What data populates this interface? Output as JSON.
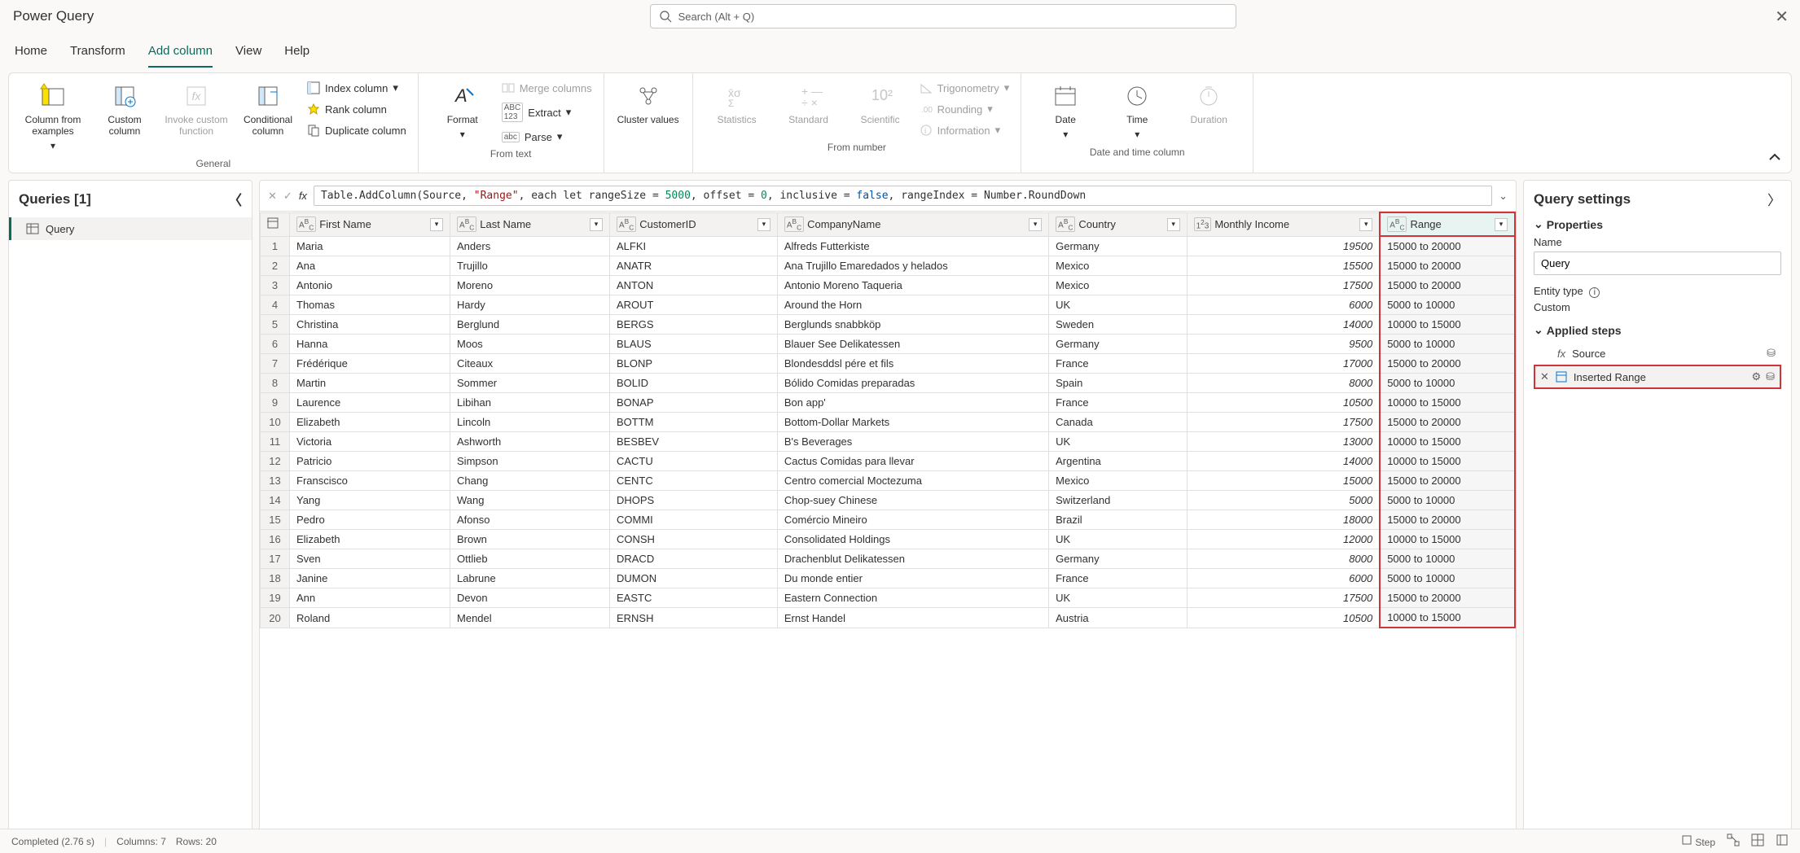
{
  "app": {
    "title": "Power Query",
    "search_placeholder": "Search (Alt + Q)"
  },
  "tabs": {
    "home": "Home",
    "transform": "Transform",
    "addcolumn": "Add column",
    "view": "View",
    "help": "Help"
  },
  "ribbon": {
    "general": {
      "col_from_examples": "Column from examples",
      "custom_column": "Custom column",
      "invoke_custom_function": "Invoke custom function",
      "conditional_column": "Conditional column",
      "index_column": "Index column",
      "rank_column": "Rank column",
      "duplicate_column": "Duplicate column",
      "label": "General"
    },
    "from_text": {
      "format": "Format",
      "merge_columns": "Merge columns",
      "extract": "Extract",
      "parse": "Parse",
      "label": "From text"
    },
    "cluster": {
      "cluster_values": "Cluster values"
    },
    "from_number": {
      "statistics": "Statistics",
      "standard": "Standard",
      "scientific": "Scientific",
      "trigonometry": "Trigonometry",
      "rounding": "Rounding",
      "information": "Information",
      "label": "From number"
    },
    "date_time": {
      "date": "Date",
      "time": "Time",
      "duration": "Duration",
      "label": "Date and time column"
    }
  },
  "queries_panel": {
    "title": "Queries [1]",
    "items": [
      "Query"
    ]
  },
  "formula": {
    "prefix": "Table.AddColumn(Source, ",
    "str": "\"Range\"",
    "mid": ", each let rangeSize = ",
    "n1": "5000",
    "mid2": ", offset = ",
    "n2": "0",
    "mid3": ", inclusive = ",
    "kw": "false",
    "mid4": ", rangeIndex = Number.RoundDown"
  },
  "columns": [
    "First Name",
    "Last Name",
    "CustomerID",
    "CompanyName",
    "Country",
    "Monthly Income",
    "Range"
  ],
  "rows": [
    {
      "n": 1,
      "fn": "Maria",
      "ln": "Anders",
      "cid": "ALFKI",
      "co": "Alfreds Futterkiste",
      "ct": "Germany",
      "mi": "19500",
      "rg": "15000 to 20000"
    },
    {
      "n": 2,
      "fn": "Ana",
      "ln": "Trujillo",
      "cid": "ANATR",
      "co": "Ana Trujillo Emaredados y helados",
      "ct": "Mexico",
      "mi": "15500",
      "rg": "15000 to 20000"
    },
    {
      "n": 3,
      "fn": "Antonio",
      "ln": "Moreno",
      "cid": "ANTON",
      "co": "Antonio Moreno Taqueria",
      "ct": "Mexico",
      "mi": "17500",
      "rg": "15000 to 20000"
    },
    {
      "n": 4,
      "fn": "Thomas",
      "ln": "Hardy",
      "cid": "AROUT",
      "co": "Around the Horn",
      "ct": "UK",
      "mi": "6000",
      "rg": "5000 to 10000"
    },
    {
      "n": 5,
      "fn": "Christina",
      "ln": "Berglund",
      "cid": "BERGS",
      "co": "Berglunds snabbköp",
      "ct": "Sweden",
      "mi": "14000",
      "rg": "10000 to 15000"
    },
    {
      "n": 6,
      "fn": "Hanna",
      "ln": "Moos",
      "cid": "BLAUS",
      "co": "Blauer See Delikatessen",
      "ct": "Germany",
      "mi": "9500",
      "rg": "5000 to 10000"
    },
    {
      "n": 7,
      "fn": "Frédérique",
      "ln": "Citeaux",
      "cid": "BLONP",
      "co": "Blondesddsl pére et fils",
      "ct": "France",
      "mi": "17000",
      "rg": "15000 to 20000"
    },
    {
      "n": 8,
      "fn": "Martin",
      "ln": "Sommer",
      "cid": "BOLID",
      "co": "Bólido Comidas preparadas",
      "ct": "Spain",
      "mi": "8000",
      "rg": "5000 to 10000"
    },
    {
      "n": 9,
      "fn": "Laurence",
      "ln": "Libihan",
      "cid": "BONAP",
      "co": "Bon app'",
      "ct": "France",
      "mi": "10500",
      "rg": "10000 to 15000"
    },
    {
      "n": 10,
      "fn": "Elizabeth",
      "ln": "Lincoln",
      "cid": "BOTTM",
      "co": "Bottom-Dollar Markets",
      "ct": "Canada",
      "mi": "17500",
      "rg": "15000 to 20000"
    },
    {
      "n": 11,
      "fn": "Victoria",
      "ln": "Ashworth",
      "cid": "BESBEV",
      "co": "B's Beverages",
      "ct": "UK",
      "mi": "13000",
      "rg": "10000 to 15000"
    },
    {
      "n": 12,
      "fn": "Patricio",
      "ln": "Simpson",
      "cid": "CACTU",
      "co": "Cactus Comidas para llevar",
      "ct": "Argentina",
      "mi": "14000",
      "rg": "10000 to 15000"
    },
    {
      "n": 13,
      "fn": "Franscisco",
      "ln": "Chang",
      "cid": "CENTC",
      "co": "Centro comercial Moctezuma",
      "ct": "Mexico",
      "mi": "15000",
      "rg": "15000 to 20000"
    },
    {
      "n": 14,
      "fn": "Yang",
      "ln": "Wang",
      "cid": "DHOPS",
      "co": "Chop-suey Chinese",
      "ct": "Switzerland",
      "mi": "5000",
      "rg": "5000 to 10000"
    },
    {
      "n": 15,
      "fn": "Pedro",
      "ln": "Afonso",
      "cid": "COMMI",
      "co": "Comércio Mineiro",
      "ct": "Brazil",
      "mi": "18000",
      "rg": "15000 to 20000"
    },
    {
      "n": 16,
      "fn": "Elizabeth",
      "ln": "Brown",
      "cid": "CONSH",
      "co": "Consolidated Holdings",
      "ct": "UK",
      "mi": "12000",
      "rg": "10000 to 15000"
    },
    {
      "n": 17,
      "fn": "Sven",
      "ln": "Ottlieb",
      "cid": "DRACD",
      "co": "Drachenblut Delikatessen",
      "ct": "Germany",
      "mi": "8000",
      "rg": "5000 to 10000"
    },
    {
      "n": 18,
      "fn": "Janine",
      "ln": "Labrune",
      "cid": "DUMON",
      "co": "Du monde entier",
      "ct": "France",
      "mi": "6000",
      "rg": "5000 to 10000"
    },
    {
      "n": 19,
      "fn": "Ann",
      "ln": "Devon",
      "cid": "EASTC",
      "co": "Eastern Connection",
      "ct": "UK",
      "mi": "17500",
      "rg": "15000 to 20000"
    },
    {
      "n": 20,
      "fn": "Roland",
      "ln": "Mendel",
      "cid": "ERNSH",
      "co": "Ernst Handel",
      "ct": "Austria",
      "mi": "10500",
      "rg": "10000 to 15000"
    }
  ],
  "settings": {
    "title": "Query settings",
    "properties": "Properties",
    "name_label": "Name",
    "name_value": "Query",
    "entity_type_label": "Entity type",
    "entity_type_value": "Custom",
    "applied_steps": "Applied steps",
    "step_source": "Source",
    "step_inserted_range": "Inserted Range"
  },
  "status": {
    "completed": "Completed (2.76 s)",
    "columns": "Columns: 7",
    "rows": "Rows: 20",
    "step": "Step"
  }
}
